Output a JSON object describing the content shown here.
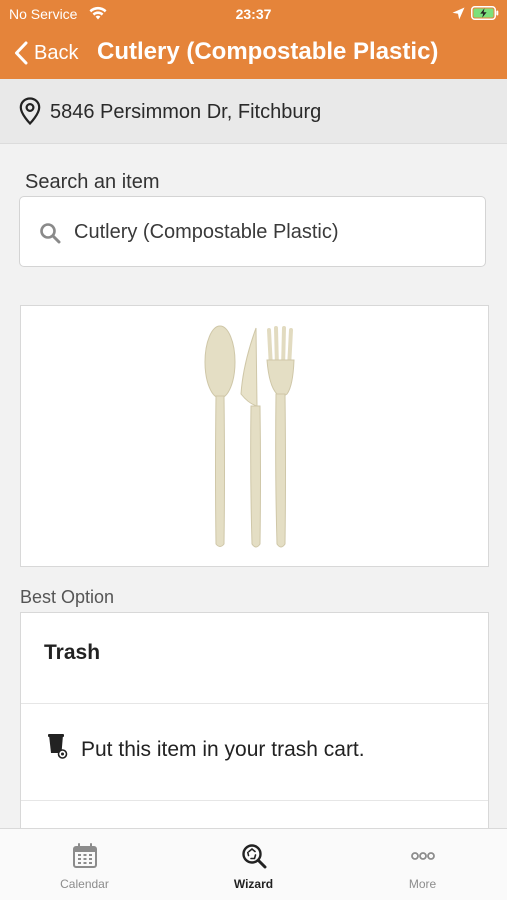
{
  "status_bar": {
    "carrier": "No Service",
    "time": "23:37",
    "wifi_icon": "wifi-icon",
    "location_icon": "location-arrow-icon",
    "battery_icon": "battery-charging-icon"
  },
  "nav": {
    "back_label": "Back",
    "title": "Cutlery (Compostable Plastic)",
    "color": "#e5843a"
  },
  "address": {
    "icon": "map-pin-icon",
    "text": "5846 Persimmon Dr, Fitchburg"
  },
  "search": {
    "label": "Search an item",
    "value": "Cutlery (Compostable Plastic)",
    "icon": "search-icon"
  },
  "item_image": {
    "icon": "cutlery-illustration"
  },
  "best_option": {
    "section_label": "Best Option",
    "title": "Trash",
    "instruction": "Put this item in your trash cart.",
    "icon": "trash-cart-icon"
  },
  "tab_bar": {
    "tabs": [
      {
        "label": "Calendar",
        "icon": "calendar-icon",
        "active": false
      },
      {
        "label": "Wizard",
        "icon": "wizard-search-icon",
        "active": true
      },
      {
        "label": "More",
        "icon": "more-dots-icon",
        "active": false
      }
    ]
  }
}
